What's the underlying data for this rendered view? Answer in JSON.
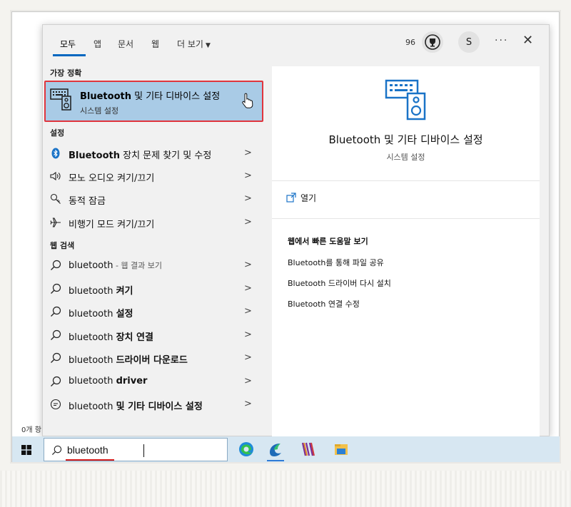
{
  "explorer_status": "0개 항",
  "tabs": [
    {
      "label": "모두",
      "active": true
    },
    {
      "label": "앱"
    },
    {
      "label": "문서"
    },
    {
      "label": "웹"
    },
    {
      "label": "더 보기"
    }
  ],
  "header": {
    "points": "96",
    "avatar_initial": "S",
    "more_label": "···",
    "close_label": "✕"
  },
  "results": {
    "best_match_title": "가장 정확",
    "best": {
      "title_bold": "Bluetooth",
      "title_rest": " 및 기타 디바이스 설정",
      "subtitle": "시스템 설정",
      "icon": "devices-icon"
    },
    "settings_title": "설정",
    "settings": [
      {
        "bold": "Bluetooth",
        "rest": " 장치 문제 찾기 및 수정",
        "icon": "bluetooth-icon"
      },
      {
        "bold": "",
        "rest": "모노 오디오 켜기/끄기",
        "icon": "speaker-icon"
      },
      {
        "bold": "",
        "rest": "동적 잠금",
        "icon": "key-icon"
      },
      {
        "bold": "",
        "rest": "비행기 모드 켜기/끄기",
        "icon": "airplane-icon"
      }
    ],
    "web_title": "웹 검색",
    "web": [
      {
        "plain": "bluetooth",
        "bold": "",
        "muted": " - 웹 결과 보기",
        "icon": "search-icon"
      },
      {
        "plain": "bluetooth ",
        "bold": "켜기",
        "muted": "",
        "icon": "search-icon"
      },
      {
        "plain": "bluetooth ",
        "bold": "설정",
        "muted": "",
        "icon": "search-icon"
      },
      {
        "plain": "bluetooth ",
        "bold": "장치 연결",
        "muted": "",
        "icon": "search-icon"
      },
      {
        "plain": "bluetooth ",
        "bold": "드라이버 다운로드",
        "muted": "",
        "icon": "search-icon"
      },
      {
        "plain": "bluetooth ",
        "bold": "driver",
        "muted": "",
        "icon": "search-icon"
      },
      {
        "plain": "bluetooth ",
        "bold": "및 기타 디바이스 설정",
        "muted": "",
        "icon": "chat-search-icon"
      }
    ]
  },
  "preview": {
    "title": "Bluetooth 및 기타 디바이스 설정",
    "subtitle": "시스템 설정",
    "open_label": "열기",
    "web_help_title": "웹에서 빠른 도움말 보기",
    "web_links": [
      "Bluetooth를 통해 파일 공유",
      "Bluetooth 드라이버 다시 설치",
      "Bluetooth 연결 수정"
    ]
  },
  "taskbar": {
    "search_value": "bluetooth",
    "apps": [
      "edge-icon",
      "ms365-icon",
      "winrar-icon",
      "file-explorer-icon"
    ]
  },
  "colors": {
    "accent": "#0067c0",
    "selected_bg": "#a9cbe6",
    "highlight_border": "#e0353d",
    "underline": "#d41c1c"
  }
}
